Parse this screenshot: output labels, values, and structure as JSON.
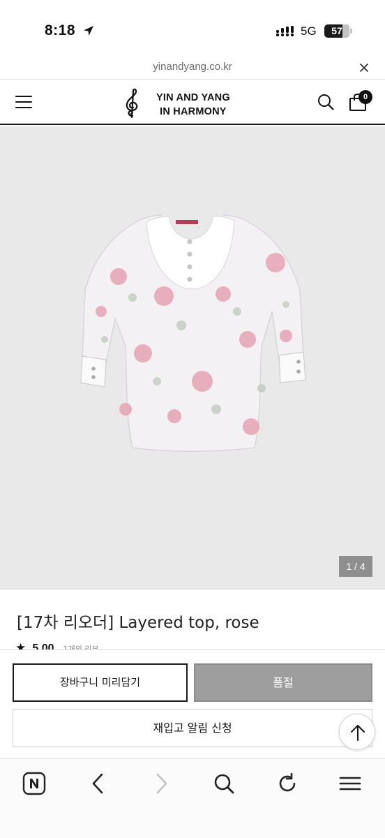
{
  "status_bar": {
    "time": "8:18",
    "network": "5G",
    "battery": "57"
  },
  "url_bar": {
    "url": "yinandyang.co.kr"
  },
  "header": {
    "logo_line1": "YIN AND YANG",
    "logo_line2": "IN HARMONY",
    "cart_count": "0"
  },
  "gallery": {
    "counter": "1 / 4"
  },
  "product": {
    "title": "[17차 리오더] Layered top, rose",
    "star": "★",
    "rating": "5.00",
    "reviews": "1개의 리뷰"
  },
  "actions": {
    "cart_label": "장바구니 미리담기",
    "soldout_label": "품절",
    "restock_label": "재입고 알림 신청"
  },
  "icons": {
    "location": "location-arrow-icon",
    "signal": "signal-icon",
    "close": "close-icon",
    "menu": "hamburger-menu-icon",
    "search": "search-icon",
    "cart": "shopping-bag-icon",
    "scroll_top": "arrow-up-icon",
    "naver": "naver-n-icon",
    "back": "chevron-left-icon",
    "forward": "chevron-right-icon",
    "reload": "reload-icon",
    "more": "hamburger-menu-icon"
  },
  "colors": {
    "soldout_bg": "#9e9e9e",
    "image_bg": "#e9e9ea",
    "text": "#111111"
  }
}
